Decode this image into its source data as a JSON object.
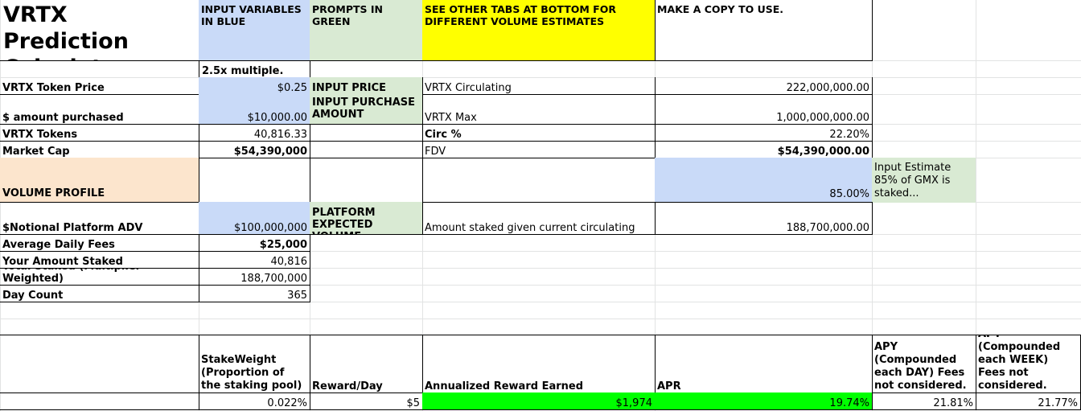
{
  "header": {
    "title_line1": "VRTX Prediction",
    "title_line2": "Calculator:",
    "note_blue": "INPUT VARIABLES IN BLUE",
    "note_green": "PROMPTS IN GREEN",
    "note_yellow": "SEE OTHER TABS AT BOTTOM FOR DIFFERENT VOLUME ESTIMATES",
    "note_copy": "MAKE A COPY TO USE."
  },
  "multiple_label": "2.5x multiple.",
  "rows": {
    "token_price": {
      "label": "VRTX Token Price",
      "value": "$0.25",
      "prompt": "INPUT PRICE",
      "right_label": "VRTX Circulating",
      "right_value": "222,000,000.00"
    },
    "amount_purchased": {
      "label": "$ amount purchased",
      "value": "$10,000.00",
      "prompt_line1": "INPUT PURCHASE",
      "prompt_line2": "AMOUNT",
      "right_label": "VRTX Max",
      "right_value": "1,000,000,000.00"
    },
    "tokens": {
      "label": "VRTX Tokens",
      "value": "40,816.33",
      "right_label": "Circ %",
      "right_value": "22.20%"
    },
    "market_cap": {
      "label": "Market Cap",
      "value": "$54,390,000",
      "right_label": "FDV",
      "right_value": "$54,390,000.00"
    },
    "volume_profile": {
      "label": "VOLUME PROFILE",
      "staked_pct": "85.00%",
      "note": "Input Estimate 85% of GMX is staked..."
    },
    "notional_adv": {
      "label": "$Notional Platform ADV",
      "value": "$100,000,000",
      "prompt_line1": "PLATFORM",
      "prompt_line2": "EXPECTED VOLUME",
      "right_label": "Amount staked given current circulating",
      "right_value": "188,700,000.00"
    },
    "daily_fees": {
      "label": "Average Daily Fees",
      "value": "$25,000"
    },
    "your_staked": {
      "label": "Your Amount Staked",
      "value": "40,816"
    },
    "total_staked": {
      "label": "Total Staked (Multiplier Weighted)",
      "value": "188,700,000"
    },
    "day_count": {
      "label": "Day Count",
      "value": "365"
    }
  },
  "results": {
    "stakeweight_label": "StakeWeight (Proportion of the staking pool)",
    "reward_day_label": "Reward/Day",
    "annualized_label": "Annualized Reward Earned",
    "apr_label": "APR",
    "apy_day_label": "APY (Compounded each DAY) Fees not considered.",
    "apy_week_label": "APY (Compounded each WEEK) Fees not considered.",
    "stakeweight_value": "0.022%",
    "reward_day_value": "$5",
    "annualized_value": "$1,974",
    "apr_value": "19.74%",
    "apy_day_value": "21.81%",
    "apy_week_value": "21.77%"
  },
  "colors": {
    "input_blue": "#c9daf8",
    "prompt_green": "#d9ead3",
    "note_yellow": "#ffff00",
    "section_peach": "#fce5cd",
    "result_lime": "#00ff00",
    "gridline": "#e2e3e3"
  }
}
